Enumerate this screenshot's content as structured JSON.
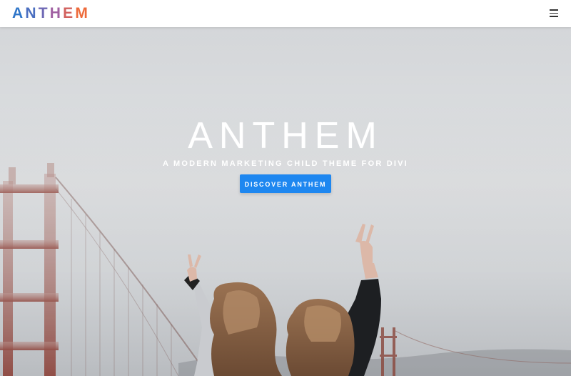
{
  "header": {
    "logo_letters": [
      {
        "char": "A",
        "color": "#2f76c9"
      },
      {
        "char": "N",
        "color": "#4b6fc0"
      },
      {
        "char": "T",
        "color": "#6f69b5"
      },
      {
        "char": "H",
        "color": "#a060a2"
      },
      {
        "char": "E",
        "color": "#d2615e"
      },
      {
        "char": "M",
        "color": "#ee6a3a"
      }
    ],
    "menu_icon": "hamburger-menu-icon"
  },
  "hero": {
    "title": "ANTHEM",
    "subtitle": "A MODERN MARKETING CHILD THEME FOR DIVI",
    "cta_label": "DISCOVER ANTHEM",
    "cta_color": "#1e87f0"
  }
}
